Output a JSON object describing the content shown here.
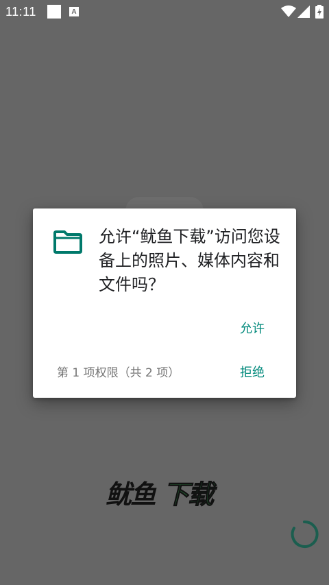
{
  "status_bar": {
    "time": "11:11",
    "icons": [
      "square-notification-icon",
      "a-notification-icon",
      "wifi-icon",
      "signal-icon",
      "battery-icon"
    ]
  },
  "dialog": {
    "icon": "folder-icon",
    "message": "允许“鱿鱼下载”访问您设备上的照片、媒体内容和文件吗？",
    "allow_label": "允许",
    "deny_label": "拒绝",
    "counter": "第 1 项权限（共 2 项）"
  },
  "splash": {
    "logo_text": "鱿鱼下载",
    "logo_left": "鱿鱼",
    "logo_right": "下载"
  },
  "colors": {
    "scrim": "#666666",
    "accent": "#00897b",
    "logo_green": "#1f4d2b",
    "spinner": "#1b5e4f"
  }
}
